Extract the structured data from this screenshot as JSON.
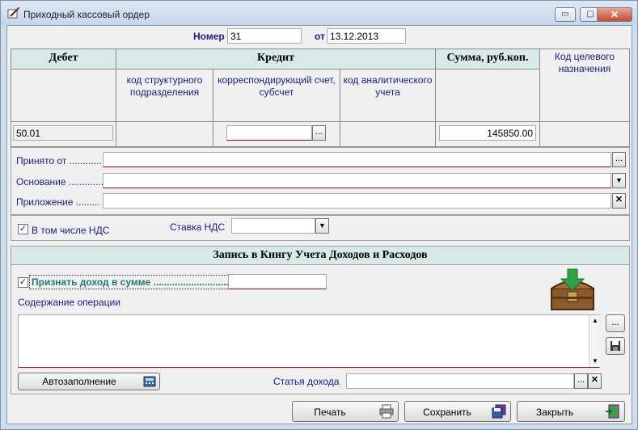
{
  "window": {
    "title": "Приходный кассовый ордер",
    "min": "▭",
    "max": "▢",
    "close": "✕"
  },
  "header": {
    "number_label": "Номер",
    "number_value": "31",
    "date_label": "от",
    "date_value": "13.12.2013"
  },
  "table": {
    "debit": "Дебет",
    "credit": "Кредит",
    "sum": "Сумма, руб.коп.",
    "target_code": "Код целевого назначения",
    "struct_unit": "код структурного подразделения",
    "corr_account": "корреспондирующий счет, субсчет",
    "analytic_code": "код аналитического учета",
    "debit_value": "50.01",
    "sum_value": "145850.00",
    "browse": "..."
  },
  "fields": {
    "received_from": "Принято от ............",
    "basis": "Основание ..............",
    "attachment": "Приложение .........",
    "browse": "...",
    "dropdown": "▼",
    "clear": "✕"
  },
  "vat": {
    "checkbox_label": "В том числе НДС",
    "checked": "✓",
    "rate_label": "Ставка НДС",
    "dropdown": "▼"
  },
  "ledger": {
    "title": "Запись в Книгу Учета Доходов и Расходов",
    "recognize_label": "Признать доход в сумме ............................",
    "checked": "✓",
    "operation_label": "Содержание операции",
    "autofill": "Автозаполнение",
    "income_item_label": "Статья дохода",
    "browse": "...",
    "clear": "✕",
    "scroll_up": "▲",
    "scroll_down": "▼"
  },
  "buttons": {
    "print": "Печать",
    "save": "Сохранить",
    "close": "Закрыть"
  },
  "colors": {
    "label_blue": "#1a1a8c",
    "header_teal": "#d8eae8",
    "required_red": "#c00000"
  }
}
